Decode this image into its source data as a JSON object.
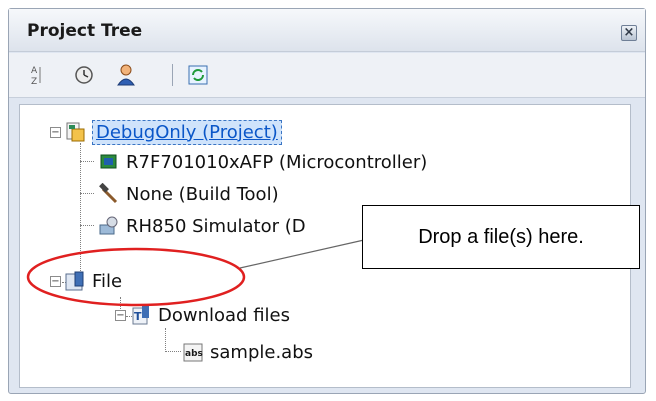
{
  "panel": {
    "title": "Project Tree"
  },
  "toolbar": {
    "buttons": [
      {
        "icon": "sort-icon"
      },
      {
        "icon": "clock-icon"
      },
      {
        "icon": "person-icon"
      },
      {
        "icon": "refresh-icon"
      }
    ]
  },
  "tree": {
    "project": "DebugOnly (Project)",
    "microcontroller": "R7F701010xAFP (Microcontroller)",
    "build_tool": "None (Build Tool)",
    "debug_tool": "RH850 Simulator (D",
    "file": "File",
    "download_files": "Download files",
    "sample": "sample.abs"
  },
  "callout": {
    "text": "Drop a file(s) here."
  },
  "colors": {
    "highlight": "#e02020",
    "selection": "#cfe3fb"
  }
}
